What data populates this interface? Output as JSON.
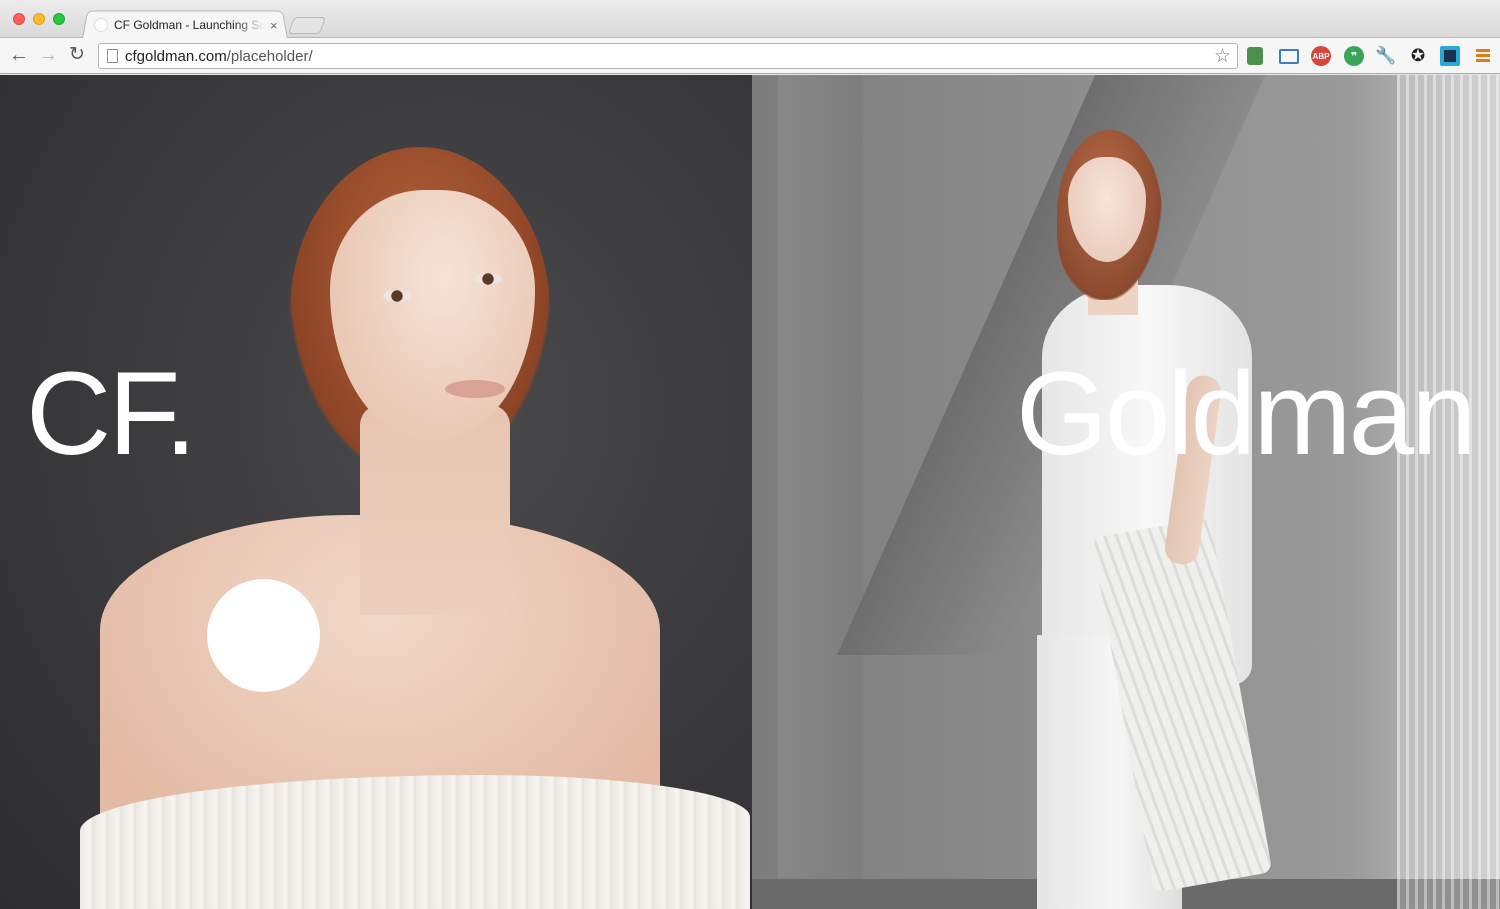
{
  "browser": {
    "tab": {
      "title": "CF Goldman - Launching Soon",
      "close_glyph": "×"
    },
    "nav": {
      "back_glyph": "←",
      "forward_glyph": "→",
      "reload_glyph": "↻"
    },
    "address": {
      "host": "cfgoldman.com",
      "path": "/placeholder/"
    },
    "bookmark_glyph": "☆",
    "extensions": [
      {
        "name": "evernote-icon",
        "label": ""
      },
      {
        "name": "screenshot-icon",
        "label": ""
      },
      {
        "name": "adblock-icon",
        "label": "ABP"
      },
      {
        "name": "hangouts-icon",
        "label": "❞"
      },
      {
        "name": "wrench-icon",
        "label": "🔧"
      },
      {
        "name": "sync-icon",
        "label": "✪"
      },
      {
        "name": "puzzle-icon",
        "label": ""
      }
    ]
  },
  "page": {
    "brand_left": "CF.",
    "brand_right": "Goldman"
  },
  "colors": {
    "left_background": "#3a3a3c",
    "right_background": "#8c8c8c",
    "brand_text": "#ffffff",
    "menu_accent": "#e07c1c"
  }
}
